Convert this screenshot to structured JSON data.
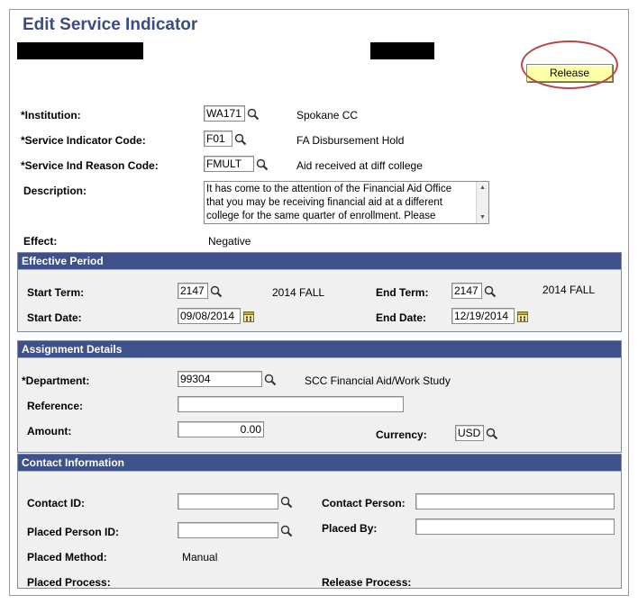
{
  "page": {
    "title": "Edit Service Indicator",
    "release_label": "Release"
  },
  "top_fields": {
    "institution": {
      "label": "*Institution:",
      "value": "WA171",
      "desc": "Spokane CC"
    },
    "service_indicator_code": {
      "label": "*Service Indicator Code:",
      "value": "F01",
      "desc": "FA Disbursement Hold"
    },
    "service_ind_reason_code": {
      "label": "*Service Ind Reason Code:",
      "value": "FMULT",
      "desc": "Aid received at diff college"
    },
    "description": {
      "label": "Description:",
      "line1": "It has come to the attention of the Financial Aid Office",
      "line2": "that you may be receiving financial aid at a different",
      "line3": "college for the same quarter of enrollment.  Please"
    },
    "effect": {
      "label": "Effect:",
      "value": "Negative"
    }
  },
  "effective_period": {
    "header": "Effective Period",
    "start_term": {
      "label": "Start Term:",
      "value": "2147",
      "desc": "2014 FALL"
    },
    "end_term": {
      "label": "End Term:",
      "value": "2147",
      "desc": "2014 FALL"
    },
    "start_date": {
      "label": "Start Date:",
      "value": "09/08/2014"
    },
    "end_date": {
      "label": "End Date:",
      "value": "12/19/2014"
    }
  },
  "assignment_details": {
    "header": "Assignment Details",
    "department": {
      "label": "*Department:",
      "value": "99304",
      "desc": "SCC Financial Aid/Work Study"
    },
    "reference": {
      "label": "Reference:",
      "value": ""
    },
    "amount": {
      "label": "Amount:",
      "value": "0.00"
    },
    "currency": {
      "label": "Currency:",
      "value": "USD"
    }
  },
  "contact_information": {
    "header": "Contact Information",
    "contact_id": {
      "label": "Contact ID:",
      "value": ""
    },
    "contact_person": {
      "label": "Contact Person:",
      "value": ""
    },
    "placed_person_id": {
      "label": "Placed Person ID:",
      "value": ""
    },
    "placed_by": {
      "label": "Placed By:",
      "value": ""
    },
    "placed_method": {
      "label": "Placed Method:",
      "value": "Manual"
    },
    "placed_process": {
      "label": "Placed Process:"
    },
    "release_process": {
      "label": "Release Process:"
    }
  },
  "colors": {
    "title": "#3d4b85",
    "group_header": "#3f518a",
    "release_button": "#ffffa8",
    "annotation_circle": "#b34a4a"
  }
}
